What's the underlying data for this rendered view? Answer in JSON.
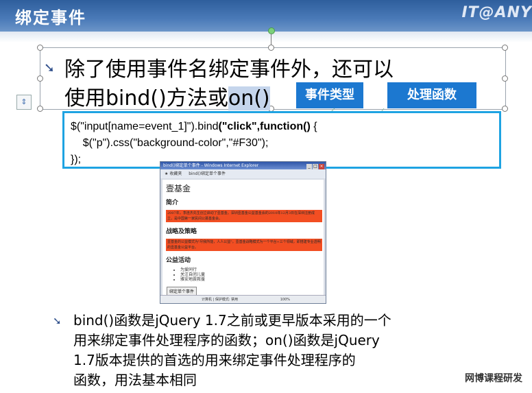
{
  "slide": {
    "title": "绑定事件",
    "logo": "IT@ANY",
    "bullet1": {
      "line1": "除了使用事件名绑定事件外，还可以",
      "line2_prefix": "使用bind()方法或",
      "line2_highlight": "on()"
    },
    "tags": [
      "事件类型",
      "处理函数"
    ],
    "code": {
      "line1_pre": "$(\"input[name=event_1]\").bind",
      "line1_bold": "(\"click\",function()",
      "line1_post": " {",
      "line2": "    $(\"p\").css(\"background-color\",\"#F30\");",
      "line3": "});"
    },
    "bullet2_lines": [
      "bind()函数是jQuery 1.7之前或更早版本采用的一个",
      "用来绑定事件处理程序的函数；on()函数是jQuery",
      " 1.7版本提供的首选的用来绑定事件处理程序的",
      "函数，用法基本相同"
    ],
    "footer": "网博课程研发"
  },
  "browser": {
    "title": "bind()绑定单个事件 - Windows Internet Explorer",
    "tab_favorites": "收藏夹",
    "tab_page": "bind()绑定单个事件",
    "heading": "壹基金",
    "section1": "简介",
    "para1": "2007年，李连杰先生创立启动了壹基金。深圳壹基金公益基金会的2010年12月3日在深圳注册成立，是中国第一家民间公募基金会。",
    "section2": "战略及策略",
    "para2": "壹基金的公益模式为\"尽我所能，人人公益\"。壹基金战略模式为一个平台+三个领域，即搭建专业透明的壹基金公益平台。",
    "section3": "公益活动",
    "activities": [
      "为爱同行",
      "关注自闭儿童",
      "雅安地震救援"
    ],
    "button": "绑定单个事件",
    "status": "计算机 | 保护模式: 禁用",
    "zoom": "100%"
  }
}
